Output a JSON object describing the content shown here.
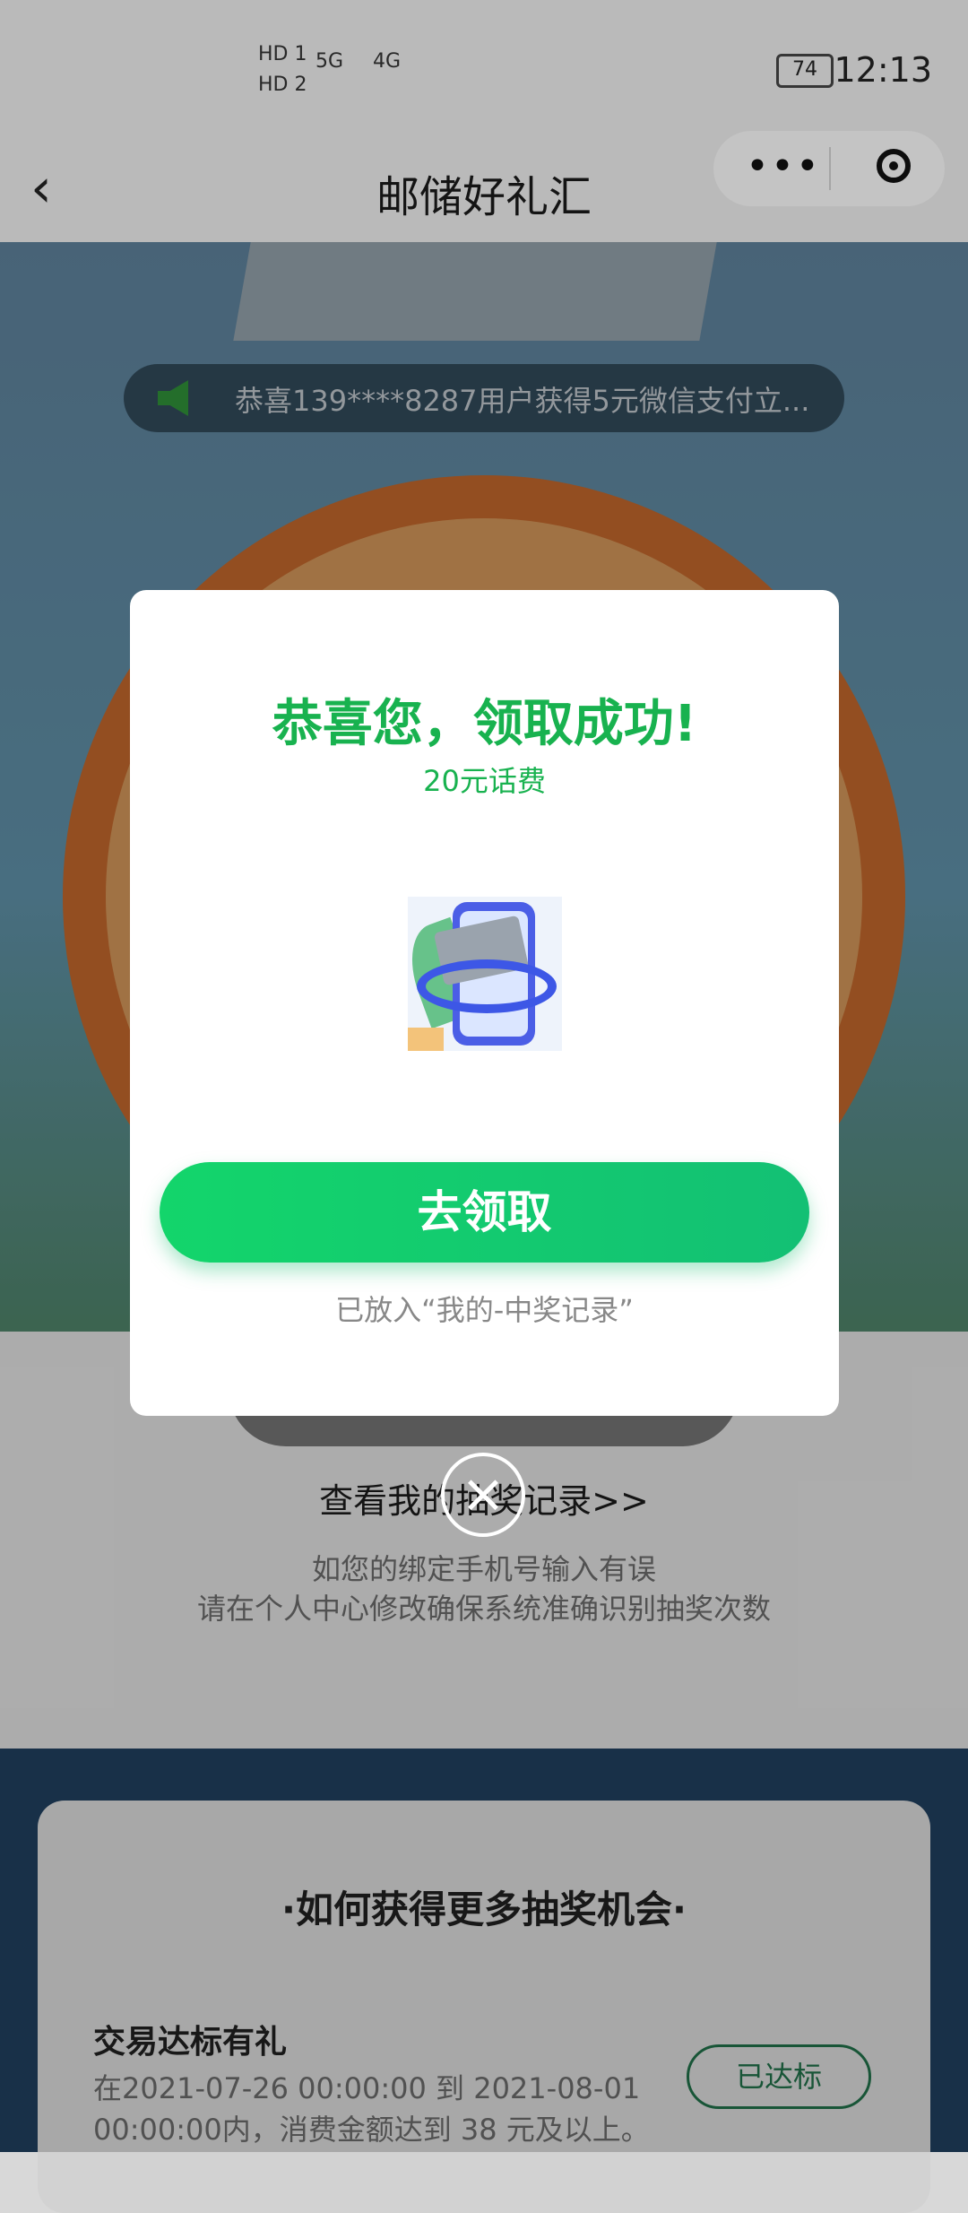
{
  "status_bar": {
    "sim1": "HD 1",
    "sim2": "HD 2",
    "net1": "5G",
    "net2": "4G",
    "battery": "74",
    "time": "12:13"
  },
  "nav": {
    "title": "邮储好礼汇",
    "back_icon": "chevron-left-icon",
    "more_icon": "more-dots-icon",
    "close_icon": "target-close-icon"
  },
  "banner": {
    "ticker": "恭喜139****8287用户获得5元微信支付立..."
  },
  "page": {
    "record_link": "查看我的抽奖记录>>",
    "tip_line1": "如您的绑定手机号输入有误",
    "tip_line2": "请在个人中心修改确保系统准确识别抽奖次数"
  },
  "bottom": {
    "section_title": "·如何获得更多抽奖机会·",
    "task_title": "交易达标有礼",
    "task_desc": "在2021-07-26 00:00:00 到 2021-08-01 00:00:00内，消费金额达到 38 元及以上。",
    "task_button": "已达标"
  },
  "modal": {
    "title": "恭喜您，领取成功!",
    "subtitle": "20元话费",
    "claim_button": "去领取",
    "note": "已放入“我的-中奖记录”"
  },
  "colors": {
    "accent_green": "#18b24f",
    "button_green": "#13c874"
  }
}
